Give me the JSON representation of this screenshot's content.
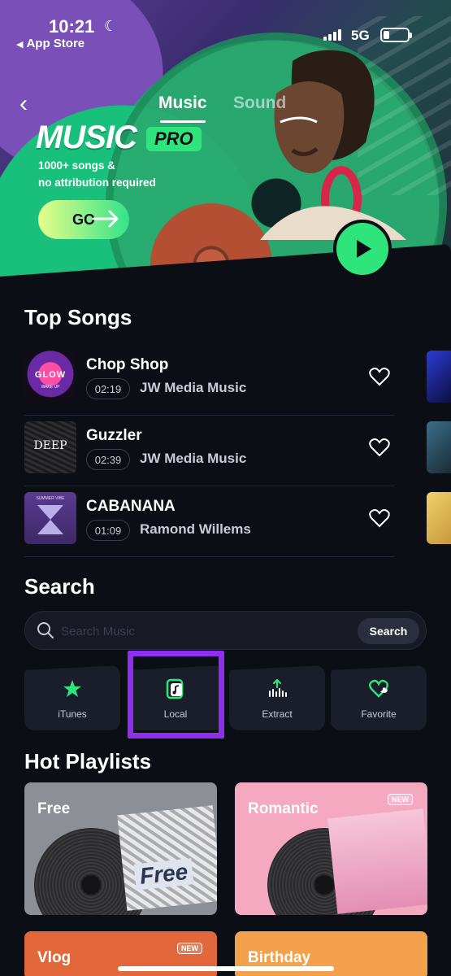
{
  "status": {
    "time": "10:21",
    "back_app": "App Store",
    "network": "5G"
  },
  "tabs": {
    "music": "Music",
    "sound": "Sound"
  },
  "promo": {
    "title": "MUSIC",
    "badge": "PRO",
    "line1": "1000+ songs &",
    "line2": "no attribution required",
    "cta": "GO"
  },
  "sections": {
    "top_songs": "Top Songs",
    "search": "Search",
    "hot_playlists": "Hot Playlists"
  },
  "songs": [
    {
      "title": "Chop Shop",
      "duration": "02:19",
      "artist": "JW Media Music",
      "cover_text": "GLOW",
      "cover_sub": "WAKE UP"
    },
    {
      "title": "Guzzler",
      "duration": "02:39",
      "artist": "JW Media Music",
      "cover_text": "DEEP"
    },
    {
      "title": "CABANANA",
      "duration": "01:09",
      "artist": "Ramond Willems",
      "cover_text": "SUMMER VIBE"
    }
  ],
  "search": {
    "placeholder": "Search Music",
    "button": "Search"
  },
  "categories": [
    {
      "label": "iTunes",
      "icon": "star-icon"
    },
    {
      "label": "Local",
      "icon": "music-file-icon"
    },
    {
      "label": "Extract",
      "icon": "extract-icon"
    },
    {
      "label": "Favorite",
      "icon": "heart-icon"
    }
  ],
  "playlists": [
    {
      "title": "Free",
      "sleeve_text": "Free",
      "new": ""
    },
    {
      "title": "Romantic",
      "new": "NEW"
    },
    {
      "title": "Vlog",
      "new": "NEW"
    },
    {
      "title": "Birthday",
      "new": ""
    }
  ],
  "colors": {
    "accent_green": "#2ee57c",
    "background": "#0c0e16",
    "highlight": "#8e2ff0"
  }
}
